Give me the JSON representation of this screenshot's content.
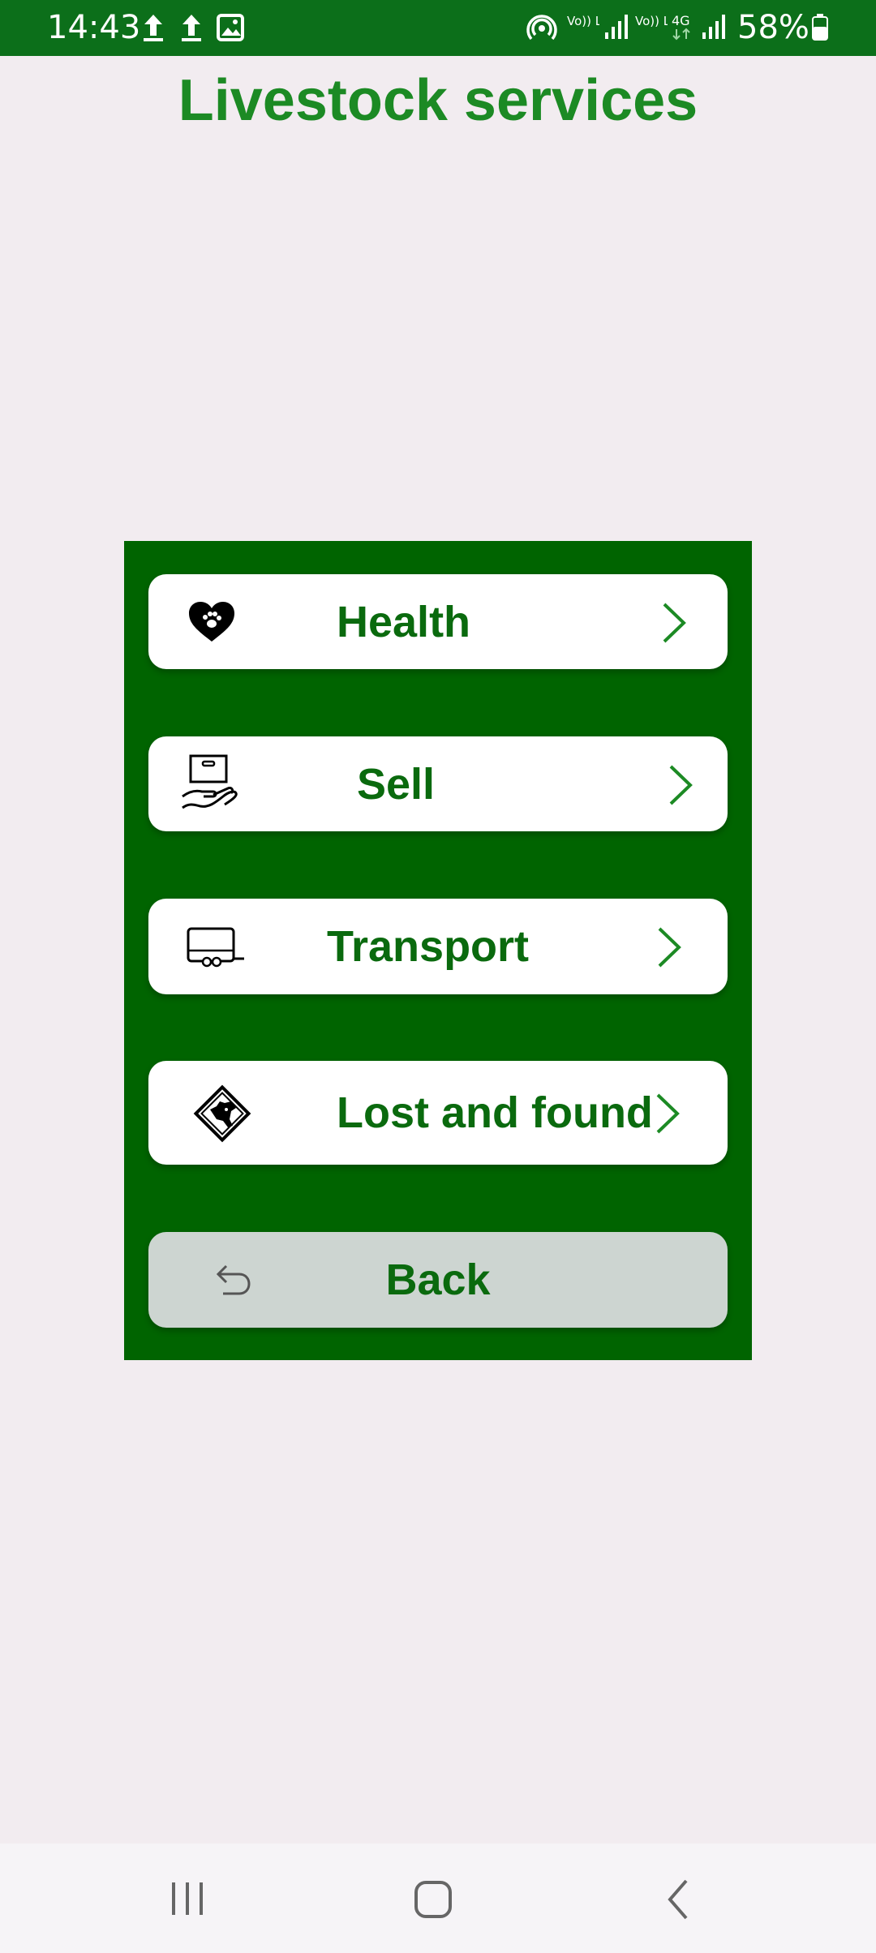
{
  "status_bar": {
    "time": "14:43",
    "network_labels": [
      "Vo)) LTE1",
      "Vo)) LTE2",
      "4G"
    ],
    "battery": "58%",
    "icons": [
      "upload-icon",
      "upload-icon",
      "image-icon",
      "hotspot-icon",
      "signal-icon",
      "signal-icon",
      "battery-icon"
    ]
  },
  "header": {
    "title": "Livestock services"
  },
  "menu": {
    "items": [
      {
        "label": "Health",
        "icon": "heart-paw-icon"
      },
      {
        "label": "Sell",
        "icon": "hand-box-icon"
      },
      {
        "label": "Transport",
        "icon": "trailer-icon"
      },
      {
        "label": "Lost and found",
        "icon": "animal-sign-icon"
      }
    ],
    "back_label": "Back",
    "back_icon": "undo-arrow-icon"
  },
  "colors": {
    "accent": "#1c8a24",
    "panel": "#006400",
    "status_bar": "#0c6f1a",
    "button_text": "#0a6a0e",
    "back_button": "#cdd5d1",
    "background": "#f2ecf0"
  },
  "nav_bar": {
    "icons": [
      "recent-apps-icon",
      "home-icon",
      "back-icon"
    ]
  }
}
